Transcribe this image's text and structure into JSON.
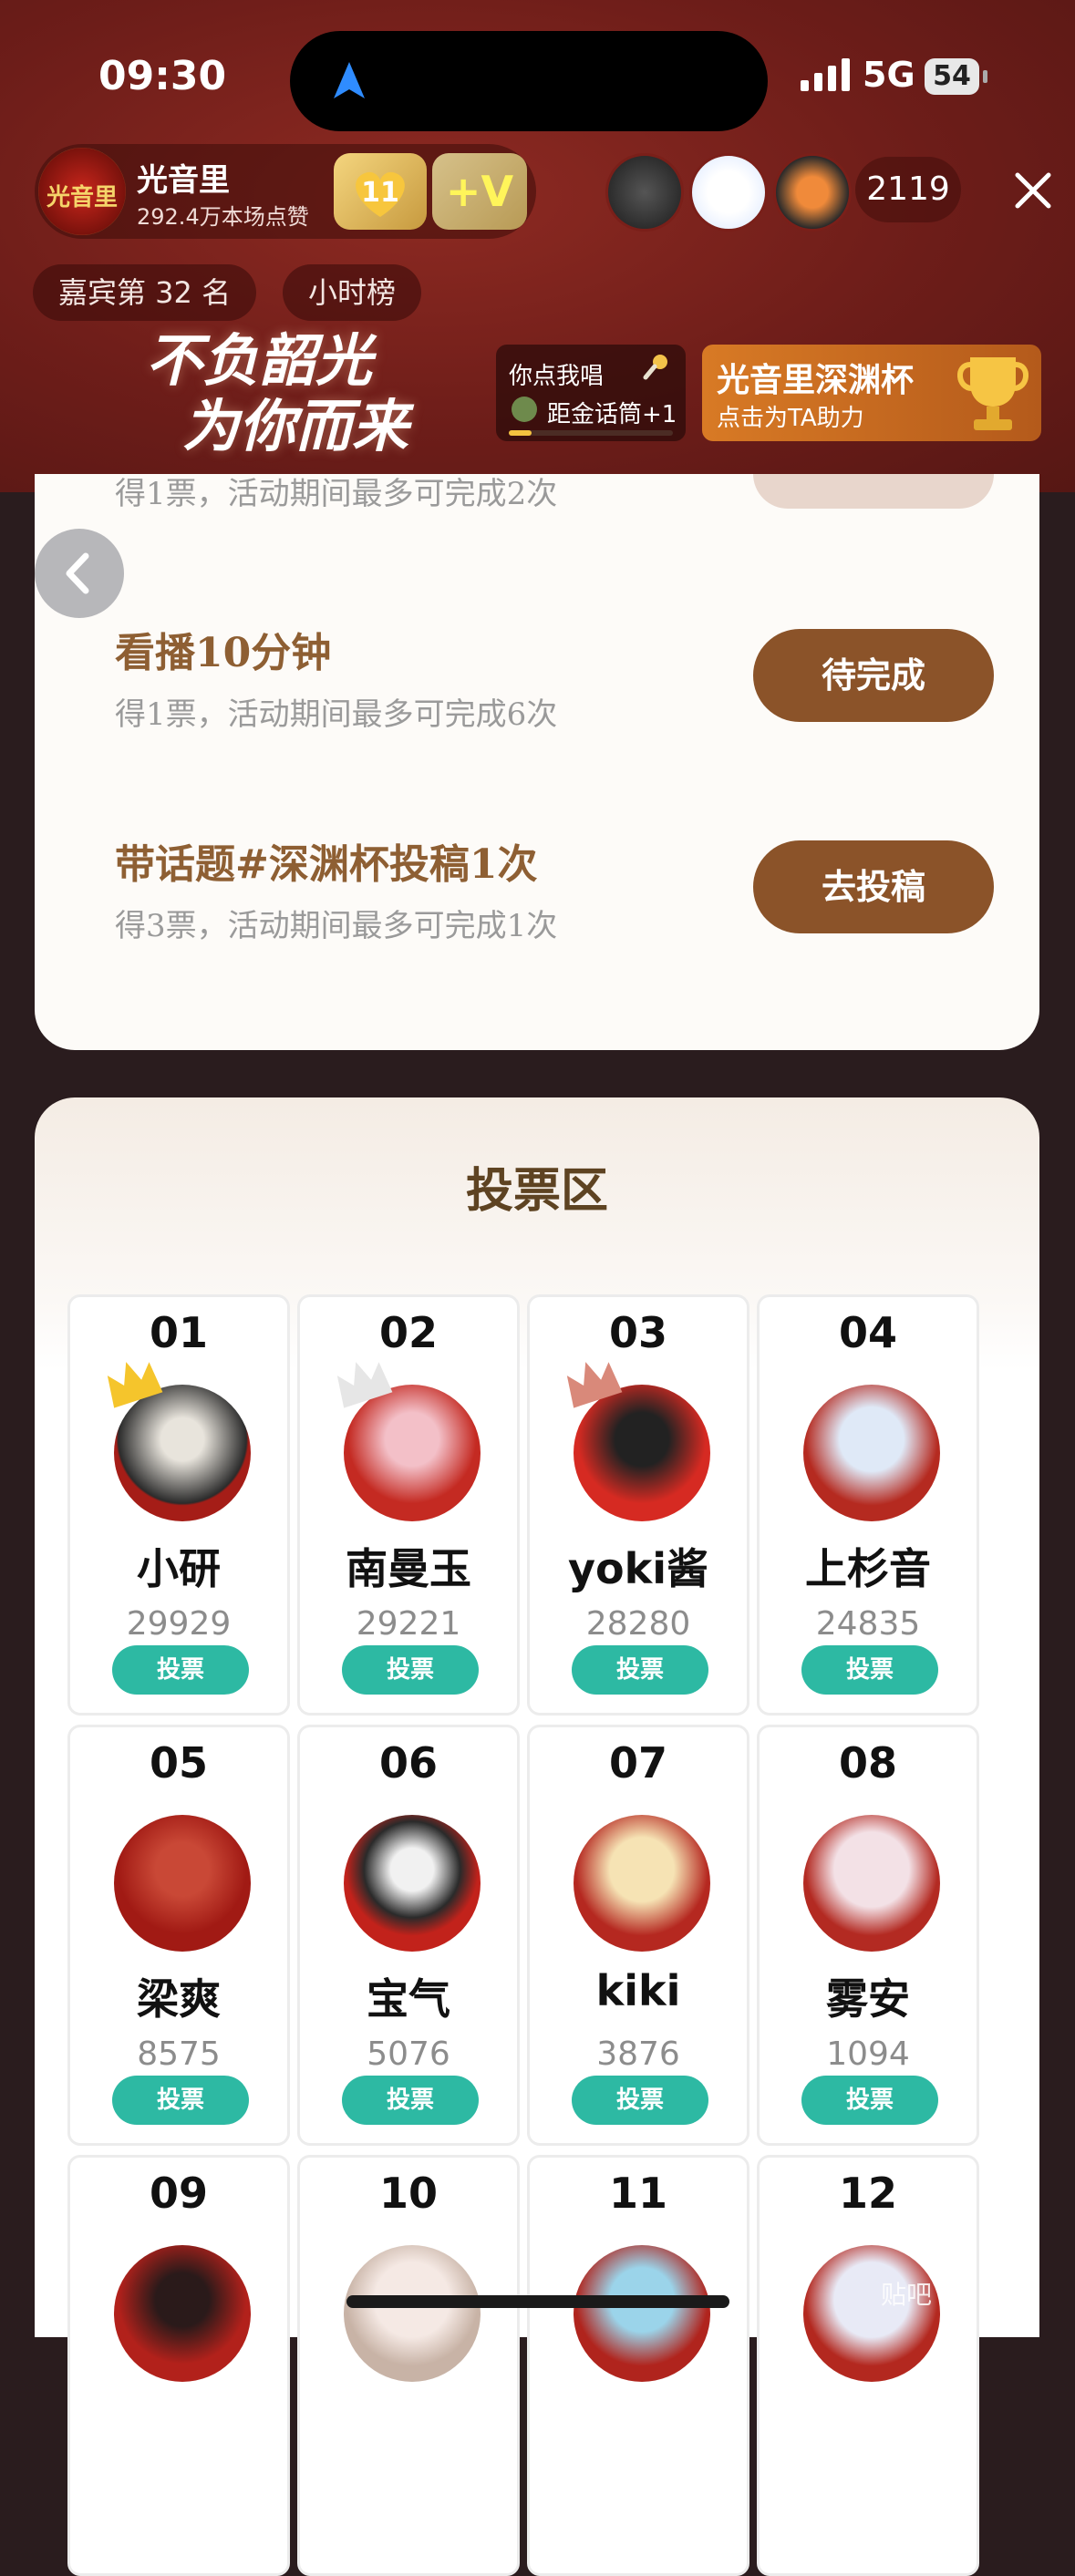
{
  "status_bar": {
    "time": "09:30",
    "network": "5G",
    "battery": "54"
  },
  "host": {
    "logo_text": "光音里",
    "name": "光音里",
    "likes": "292.4万本场点赞",
    "level": "11",
    "plus": "+V"
  },
  "viewers": {
    "count": "2119"
  },
  "pills": {
    "rank": "嘉宾第 32 名",
    "board": "小时榜"
  },
  "banner": {
    "line1": "不负韶光",
    "line2": "为你而来",
    "task_line1": "你点我唱",
    "task_line2": "距金话筒+1",
    "task_progress": 0.14,
    "cup_title": "光音里深渊杯",
    "cup_sub": "点击为TA助力"
  },
  "tasks": {
    "partial_text": "得1票，活动期间最多可完成2次",
    "items": [
      {
        "title": "看播10分钟",
        "sub": "得1票，活动期间最多可完成6次",
        "button": "待完成"
      },
      {
        "title": "带话题#深渊杯投稿1次",
        "sub": "得3票，活动期间最多可完成1次",
        "button": "去投稿"
      }
    ]
  },
  "vote": {
    "title": "投票区",
    "button_label": "投票",
    "candidates": [
      {
        "no": "01",
        "name": "小研",
        "votes": "29929"
      },
      {
        "no": "02",
        "name": "南曼玉",
        "votes": "29221"
      },
      {
        "no": "03",
        "name": "yoki酱",
        "votes": "28280"
      },
      {
        "no": "04",
        "name": "上杉音",
        "votes": "24835"
      },
      {
        "no": "05",
        "name": "梁爽",
        "votes": "8575"
      },
      {
        "no": "06",
        "name": "宝气",
        "votes": "5076"
      },
      {
        "no": "07",
        "name": "kiki",
        "votes": "3876"
      },
      {
        "no": "08",
        "name": "雾安",
        "votes": "1094"
      },
      {
        "no": "09"
      },
      {
        "no": "10"
      },
      {
        "no": "11"
      },
      {
        "no": "12"
      }
    ]
  },
  "watermark": "贴吧",
  "colors": {
    "accent_brown": "#8b5329",
    "vote_teal": "#2db9a3",
    "header_red": "#6d1d19"
  }
}
